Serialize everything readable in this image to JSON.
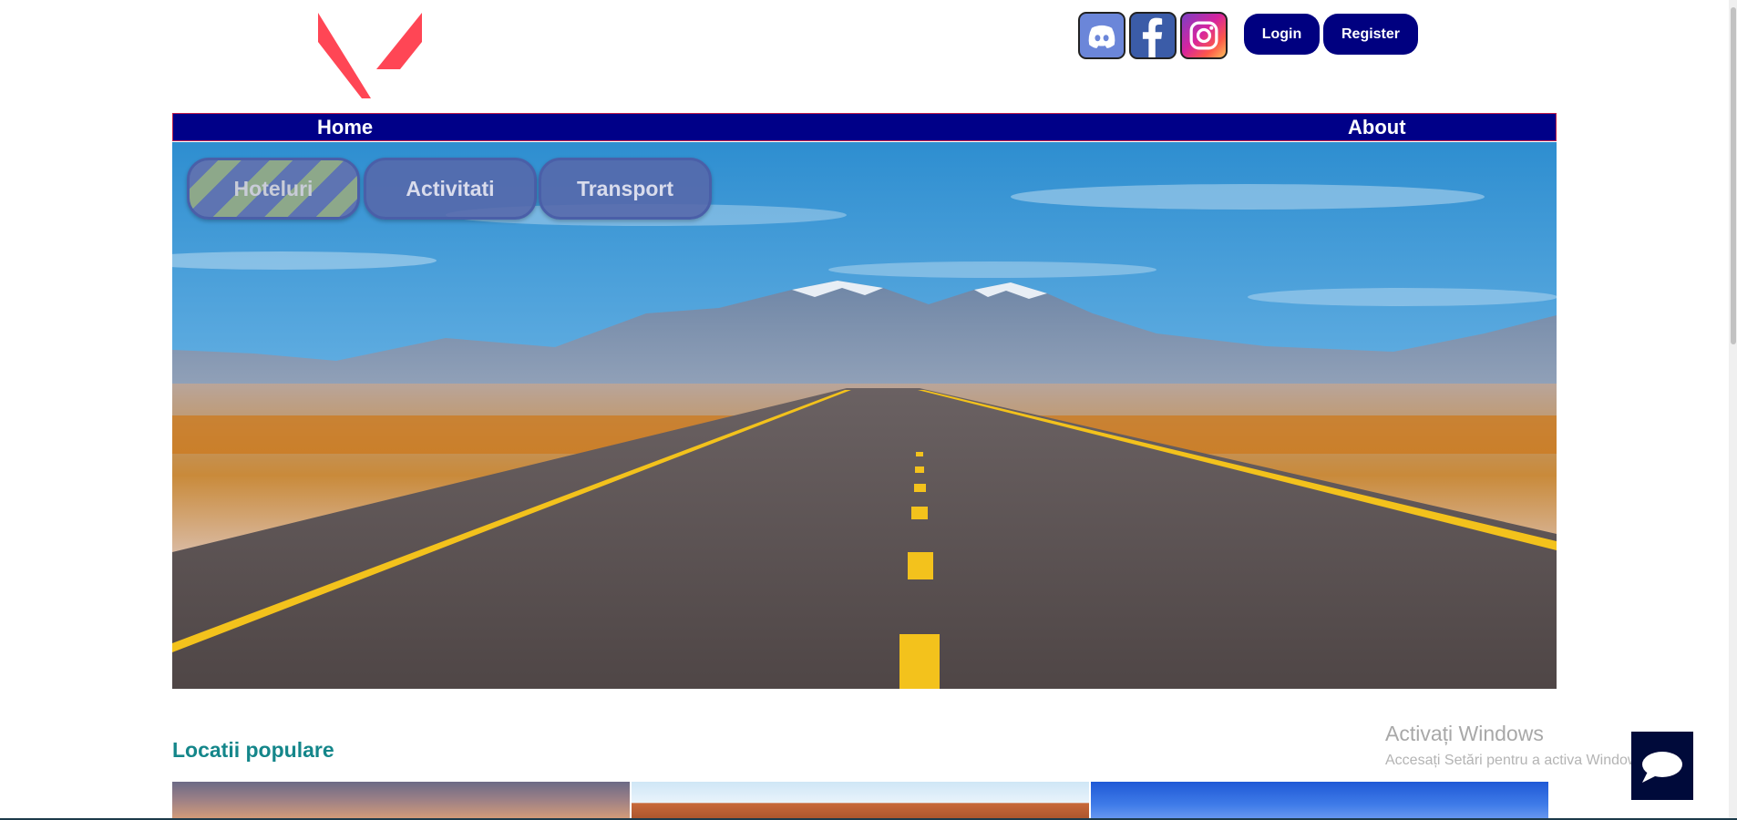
{
  "header": {
    "logo_icon": "valorant-v-logo-icon",
    "social": [
      {
        "name": "discord",
        "icon": "discord-icon"
      },
      {
        "name": "facebook",
        "icon": "facebook-icon"
      },
      {
        "name": "instagram",
        "icon": "instagram-icon"
      }
    ],
    "login_label": "Login",
    "register_label": "Register"
  },
  "nav": {
    "home_label": "Home",
    "about_label": "About"
  },
  "hero": {
    "image": "desert-road-mountains",
    "tabs": [
      {
        "label": "Hoteluri"
      },
      {
        "label": "Activitati"
      },
      {
        "label": "Transport"
      }
    ]
  },
  "section": {
    "title": "Locatii populare"
  },
  "watermark": {
    "title": "Activați Windows",
    "subtitle": "Accesați Setări pentru a activa Windows."
  },
  "chat": {
    "icon": "chat-bubble-icon"
  },
  "colors": {
    "nav_bg": "#000088",
    "button_bg": "#000080",
    "logo": "#ff4655",
    "section_title": "#14868a"
  }
}
